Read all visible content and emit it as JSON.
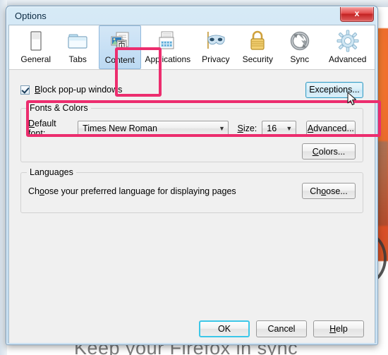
{
  "window": {
    "title": "Options",
    "close_label": "x",
    "close_icon": "close-icon"
  },
  "background": {
    "tagline": "Keep your Firefox in sync"
  },
  "tabs": [
    {
      "label": "General",
      "icon": "browser-window-icon",
      "selected": false
    },
    {
      "label": "Tabs",
      "icon": "tabs-folder-icon",
      "selected": false
    },
    {
      "label": "Content",
      "icon": "content-page-icon",
      "selected": true
    },
    {
      "label": "Applications",
      "icon": "applications-icon",
      "selected": false
    },
    {
      "label": "Privacy",
      "icon": "mask-icon",
      "selected": false
    },
    {
      "label": "Security",
      "icon": "padlock-icon",
      "selected": false
    },
    {
      "label": "Sync",
      "icon": "sync-arrows-icon",
      "selected": false
    },
    {
      "label": "Advanced",
      "icon": "gear-icon",
      "selected": false
    }
  ],
  "content_panel": {
    "popup": {
      "checkbox_checked": true,
      "label_before": "B",
      "label_after": "lock pop-up windows",
      "exceptions_label": "Exceptions..."
    },
    "fonts_colors": {
      "group_title": "Fonts & Colors",
      "default_font_label_before": "D",
      "default_font_label_after": "efault font:",
      "default_font_value": "Times New Roman",
      "size_label_before": "S",
      "size_label_after": "ize:",
      "size_value": "16",
      "advanced_label_before": "A",
      "advanced_label_after": "dvanced...",
      "colors_label_before": "C",
      "colors_label_after": "olors...",
      "dropdown_arrow": "▼"
    },
    "languages": {
      "group_title": "Languages",
      "description_before": "Ch",
      "description_mid": "o",
      "description_after": "ose your preferred language for displaying pages",
      "choose_label_before": "Ch",
      "choose_label_mid": "o",
      "choose_label_after": "ose..."
    }
  },
  "footer": {
    "ok_label": "OK",
    "cancel_label": "Cancel",
    "help_label_before": "H",
    "help_label_after": "elp"
  },
  "annotations": {
    "color": "#ec2d6e",
    "highlight_content_tab": "content-tab-highlight",
    "highlight_popup_row": "popup-blocker-row-highlight"
  }
}
